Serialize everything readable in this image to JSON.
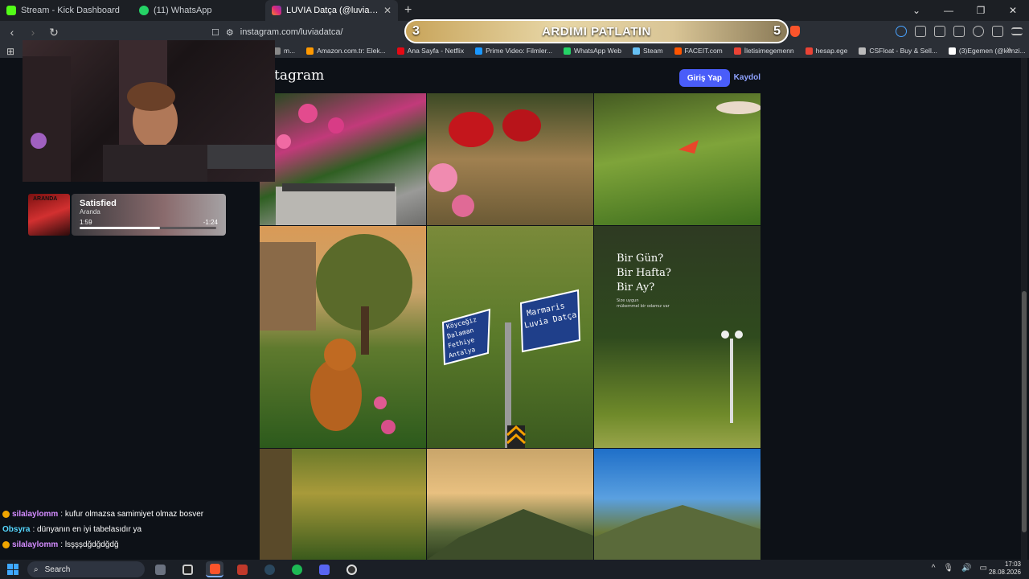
{
  "browser": {
    "tabs": [
      {
        "label": "Stream - Kick Dashboard",
        "color": "#53fc18"
      },
      {
        "label": "(11) WhatsApp",
        "color": "#25d366"
      },
      {
        "label": "LUVIA Datça (@luviadatca) • Inst",
        "color": "#e1306c"
      }
    ],
    "new_tab": "+",
    "url": "instagram.com/luviadatca/",
    "bookmarks": [
      {
        "label": "m...",
        "color": "#888"
      },
      {
        "label": "Amazon.com.tr: Elek...",
        "color": "#ff9900"
      },
      {
        "label": "Ana Sayfa - Netflix",
        "color": "#e50914"
      },
      {
        "label": "Prime Video: Filmler...",
        "color": "#1a98ff"
      },
      {
        "label": "WhatsApp Web",
        "color": "#25d366"
      },
      {
        "label": "Steam",
        "color": "#66c0f4"
      },
      {
        "label": "FACEIT.com",
        "color": "#ff5500"
      },
      {
        "label": "İletisimegemenn",
        "color": "#ea4335"
      },
      {
        "label": "hesap.ege",
        "color": "#ea4335"
      },
      {
        "label": "CSFloat - Buy & Sell...",
        "color": "#bbbbbb"
      },
      {
        "label": "(3)Egemen (@kenzi...",
        "color": "#ffffff"
      }
    ]
  },
  "alert": {
    "left_count": "3",
    "text": "ARDIMI PATLATIN",
    "right_count": "5"
  },
  "instagram": {
    "logo": "tagram",
    "login": "Giriş Yap",
    "signup": "Kaydol",
    "post_text": {
      "line1": "Bir Gün?",
      "line2": "Bir Hafta?",
      "line3": "Bir Ay?",
      "small1": "Size uygun",
      "small2": "mükemmel bir odamız var",
      "sign_left": [
        "Köyceğiz",
        "Dalaman",
        "Fethiye",
        "Antalya"
      ],
      "sign_right": [
        "Marmaris",
        "Luvia Datça"
      ]
    }
  },
  "player": {
    "song": "Satisfied",
    "artist": "Aranda",
    "elapsed": "1:59",
    "remaining": "-1:24",
    "progress": 0.59,
    "album_text": "ARANDA"
  },
  "chat": [
    {
      "user": "silalaylomm",
      "text": ": kufur olmazsa samimiyet olmaz bosver",
      "badge": true,
      "color": "#d48cff"
    },
    {
      "user": "Obsyra",
      "text": ": dünyanın en iyi tabelasıdır ya",
      "badge": false,
      "color": "#55d8ff"
    },
    {
      "user": "silalaylomm",
      "text": ": lsşşşdğdğdğdğ",
      "badge": true,
      "color": "#d48cff"
    }
  ],
  "taskbar": {
    "search": "Search",
    "time": "17:03",
    "date": "28.08.2026"
  }
}
